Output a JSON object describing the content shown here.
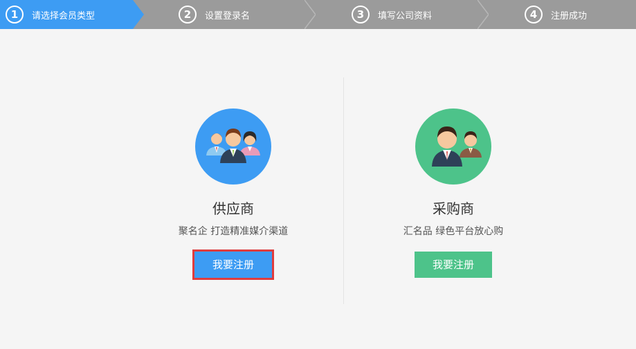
{
  "steps": [
    {
      "num": "1",
      "label": "请选择会员类型"
    },
    {
      "num": "2",
      "label": "设置登录名"
    },
    {
      "num": "3",
      "label": "填写公司资料"
    },
    {
      "num": "4",
      "label": "注册成功"
    }
  ],
  "supplier": {
    "title": "供应商",
    "desc": "聚名企 打造精准媒介渠道",
    "button": "我要注册"
  },
  "buyer": {
    "title": "采购商",
    "desc": "汇名品 绿色平台放心购",
    "button": "我要注册"
  },
  "colors": {
    "active": "#3d9cf3",
    "inactive": "#9b9b9b",
    "supplier": "#3d9cf3",
    "buyer": "#4dc38a",
    "highlight": "#e03c3c"
  }
}
